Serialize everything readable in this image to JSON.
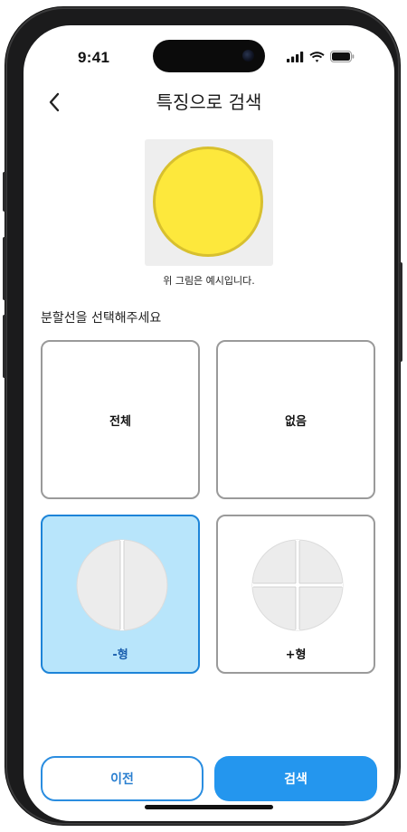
{
  "status_bar": {
    "time": "9:41",
    "icons": [
      "signal-icon",
      "wifi-icon",
      "battery-icon"
    ]
  },
  "header": {
    "back_icon": "chevron-left-icon",
    "title": "특징으로 검색"
  },
  "example": {
    "pill_color": "#fde83c",
    "caption": "위 그림은 예시입니다."
  },
  "section": {
    "label": "분할선을 선택해주세요"
  },
  "options": [
    {
      "label": "전체",
      "selected": false
    },
    {
      "label": "없음",
      "selected": false
    },
    {
      "label": "-형",
      "selected": true
    },
    {
      "label": "+형",
      "selected": false
    }
  ],
  "buttons": {
    "prev": "이전",
    "search": "검색"
  },
  "colors": {
    "accent": "#2496ee",
    "selected_bg": "#b8e5fb",
    "selected_border": "#1d84d8"
  }
}
